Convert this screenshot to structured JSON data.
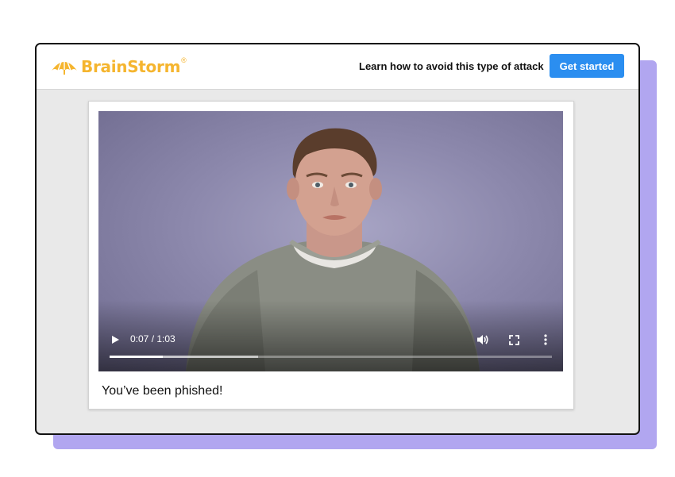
{
  "brand": {
    "name": "BrainStorm",
    "registered_mark": "®",
    "color": "#f5b52f"
  },
  "header": {
    "prompt_text": "Learn how to avoid this type of attack",
    "cta_label": "Get started",
    "cta_color": "#2b8ef0"
  },
  "video": {
    "current_time": "0:07",
    "duration": "1:03",
    "time_display": "0:07 / 1:03",
    "progress_fraction": 0.12,
    "buffered_fraction": 0.335,
    "controls": [
      "play-icon",
      "volume-icon",
      "fullscreen-icon",
      "more-options-icon"
    ]
  },
  "caption": "You’ve been phished!",
  "accent_shadow_color": "#b1a6f0"
}
